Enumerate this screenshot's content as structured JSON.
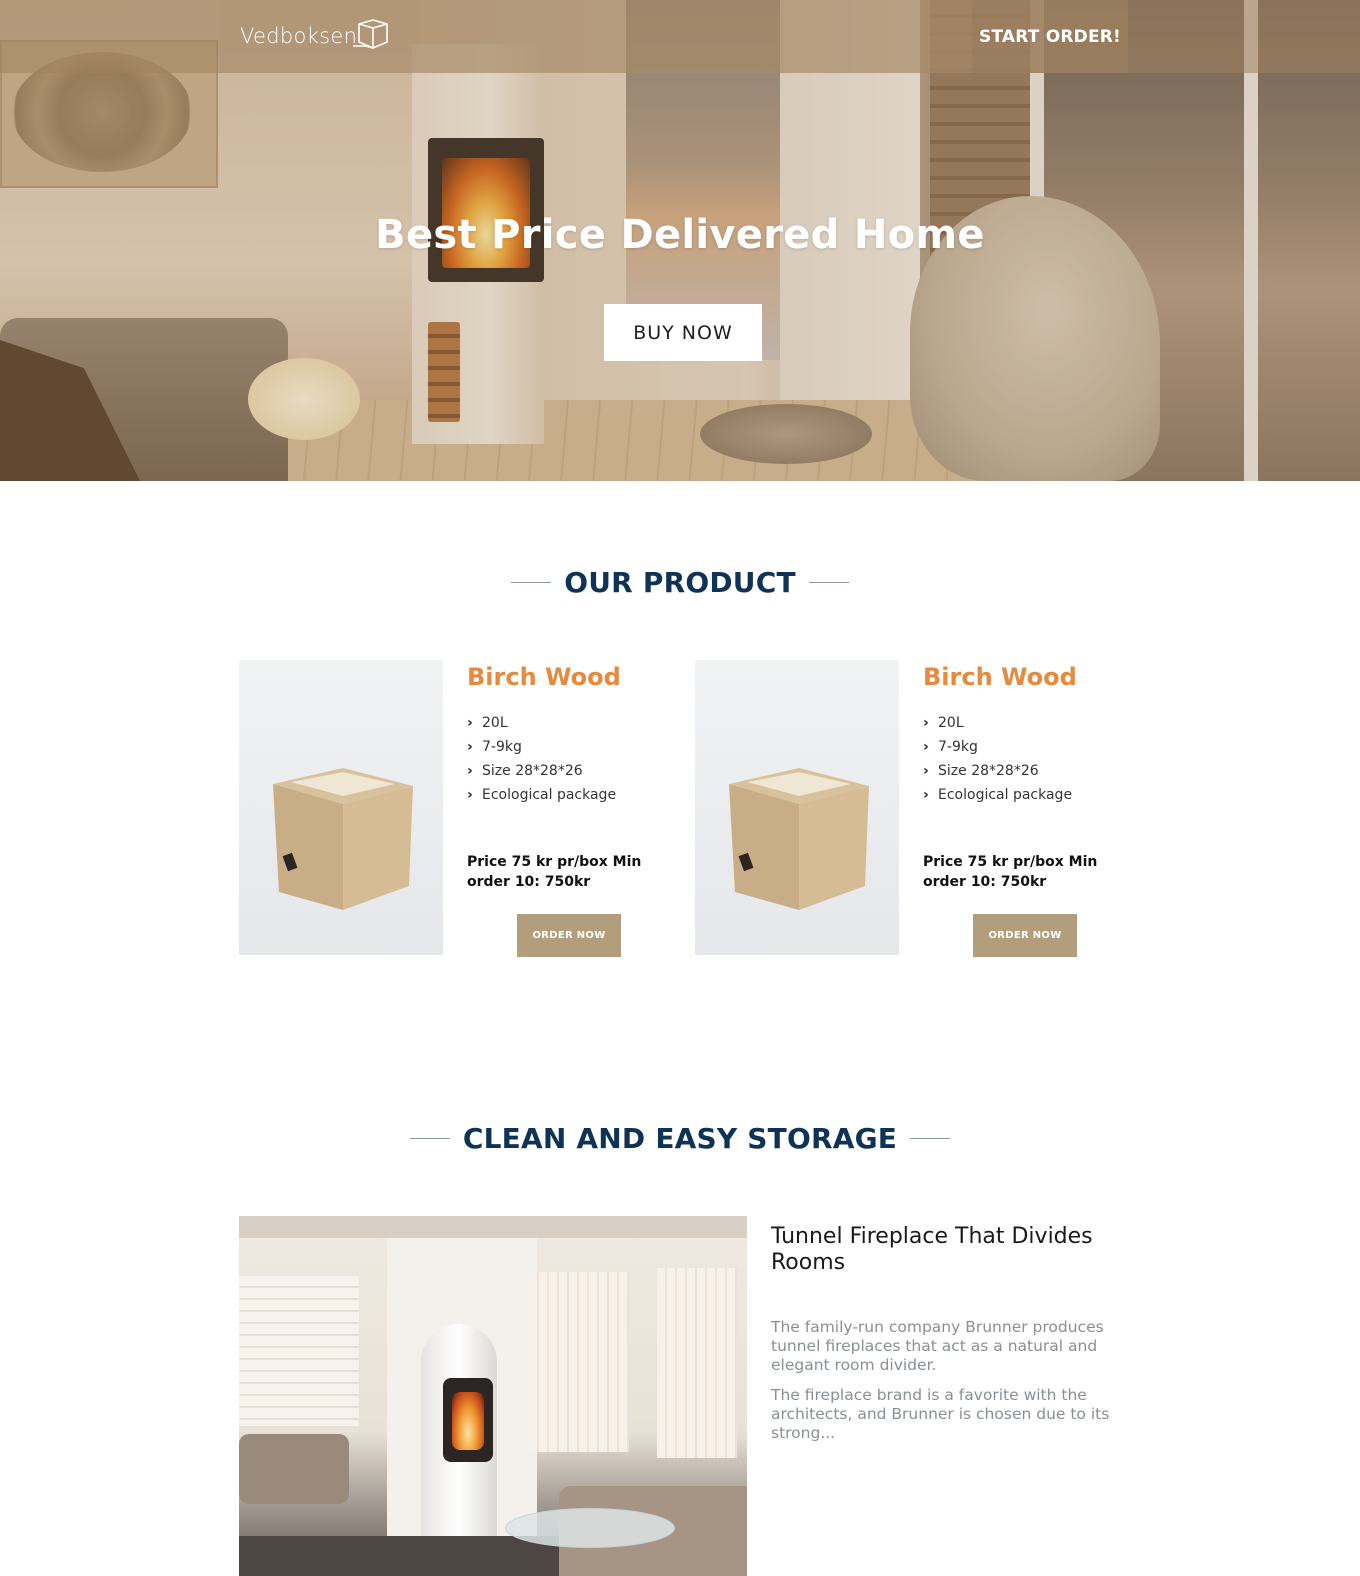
{
  "header": {
    "logo_text": "Vedboksen",
    "cta_label": "START ORDER!"
  },
  "hero": {
    "title": "Best Price Delivered Home",
    "button_label": "BUY NOW"
  },
  "products_section": {
    "heading": "OUR PRODUCT",
    "products": [
      {
        "name": "Birch Wood",
        "features": [
          "20L",
          "7-9kg",
          "Size 28*28*26",
          "Ecological package"
        ],
        "price": "Price 75 kr pr/box Min order 10: 750kr",
        "button_label": "ORDER NOW"
      },
      {
        "name": "Birch Wood",
        "features": [
          "20L",
          "7-9kg",
          "Size 28*28*26",
          "Ecological package"
        ],
        "price": "Price 75 kr pr/box Min order 10: 750kr",
        "button_label": "ORDER NOW"
      }
    ]
  },
  "storage_section": {
    "heading": "CLEAN AND EASY STORAGE",
    "article_title": "Tunnel Fireplace That Divides Rooms",
    "paragraph_1": "The family-run company Brunner produces tunnel fireplaces that act as a natural and elegant room divider.",
    "paragraph_2": "The fireplace brand is a favorite with the architects, and Brunner is chosen due to its strong..."
  },
  "colors": {
    "heading_navy": "#0f3354",
    "product_orange": "#e58a3f",
    "order_button": "#b39e7c",
    "body_grey": "#8a8f96"
  },
  "icons": [
    "logo-box-icon",
    "chevron-right-icon"
  ]
}
